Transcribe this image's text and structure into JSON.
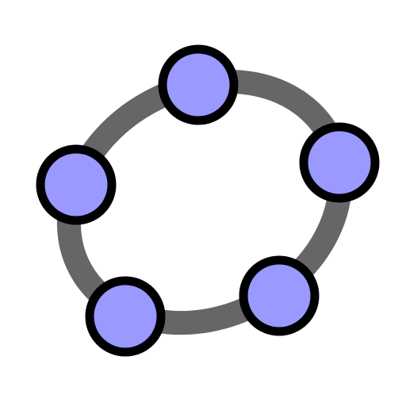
{
  "logo": {
    "icon": "geogebra-logo-icon",
    "ring_color": "#666666",
    "point_fill": "#9999ff",
    "point_stroke": "#000000",
    "background": "#ffffff",
    "point_count": 5
  }
}
